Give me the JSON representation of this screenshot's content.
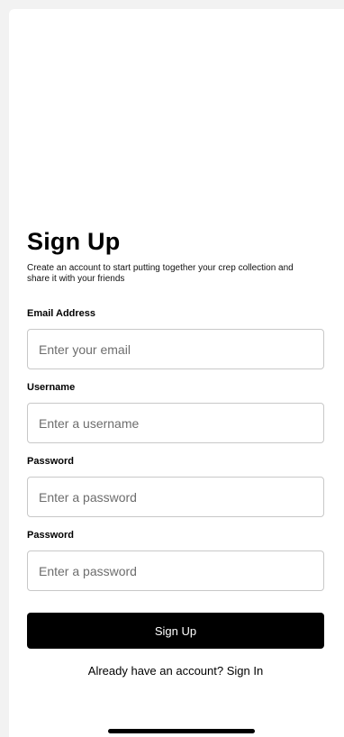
{
  "header": {
    "title": "Sign Up",
    "subtitle": "Create an account to start putting together your crep collection and share it with your friends"
  },
  "form": {
    "email": {
      "label": "Email Address",
      "placeholder": "Enter your email",
      "value": ""
    },
    "username": {
      "label": "Username",
      "placeholder": "Enter a username",
      "value": ""
    },
    "password": {
      "label": "Password",
      "placeholder": "Enter a password",
      "value": ""
    },
    "confirm_password": {
      "label": "Password",
      "placeholder": "Enter a password",
      "value": ""
    },
    "submit_label": "Sign Up"
  },
  "footer": {
    "prompt": "Already have an account?",
    "link_label": "Sign In"
  },
  "colors": {
    "background": "#ffffff",
    "button": "#000000",
    "button_text": "#ffffff",
    "input_border": "#c8c8c8",
    "placeholder": "#6d6d6d"
  }
}
